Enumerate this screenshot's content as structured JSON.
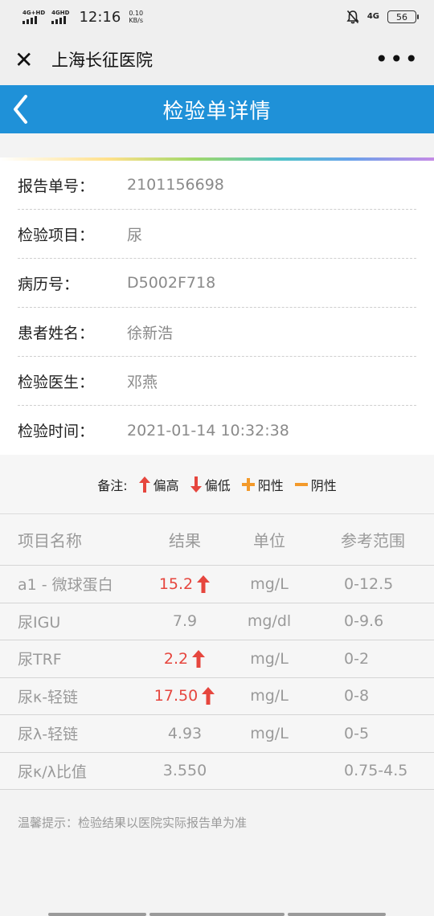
{
  "status": {
    "net1": "4G+HD",
    "net2": "4GHD",
    "time": "12:16",
    "speed_value": "0.10",
    "speed_unit": "KB/s",
    "net3": "4G",
    "battery": "56"
  },
  "titlebar": {
    "title": "上海长征医院",
    "close_glyph": "✕",
    "more_glyph": "•••"
  },
  "header": {
    "title": "检验单详情",
    "back_glyph": "‹"
  },
  "info": [
    {
      "label": "报告单号：",
      "value": "2101156698"
    },
    {
      "label": "检验项目：",
      "value": "尿"
    },
    {
      "label": "病历号：",
      "value": "D5002F718"
    },
    {
      "label": "患者姓名：",
      "value": "徐新浩"
    },
    {
      "label": "检验医生：",
      "value": "邓燕"
    },
    {
      "label": "检验时间：",
      "value": "2021-01-14 10:32:38"
    }
  ],
  "legend": {
    "prefix": "备注:",
    "high": "偏高",
    "low": "偏低",
    "positive": "阳性",
    "negative": "阴性",
    "colors": {
      "high": "#e6463e",
      "low": "#e6463e",
      "positive": "#f39a2b",
      "negative": "#f39a2b"
    }
  },
  "table": {
    "headers": [
      "项目名称",
      "结果",
      "单位",
      "参考范围"
    ],
    "rows": [
      {
        "name": "a1 - 微球蛋白",
        "result": "15.2",
        "unit": "mg/L",
        "ref": "0-12.5",
        "flag": "high"
      },
      {
        "name": "尿IGU",
        "result": "7.9",
        "unit": "mg/dl",
        "ref": "0-9.6",
        "flag": ""
      },
      {
        "name": "尿TRF",
        "result": "2.2",
        "unit": "mg/L",
        "ref": "0-2",
        "flag": "high"
      },
      {
        "name": "尿κ-轻链",
        "result": "17.50",
        "unit": "mg/L",
        "ref": "0-8",
        "flag": "high"
      },
      {
        "name": "尿λ-轻链",
        "result": "4.93",
        "unit": "mg/L",
        "ref": "0-5",
        "flag": ""
      },
      {
        "name": "尿κ/λ比值",
        "result": "3.550",
        "unit": "",
        "ref": "0.75-4.5",
        "flag": ""
      }
    ]
  },
  "tip": "温馨提示：检验结果以医院实际报告单为准"
}
